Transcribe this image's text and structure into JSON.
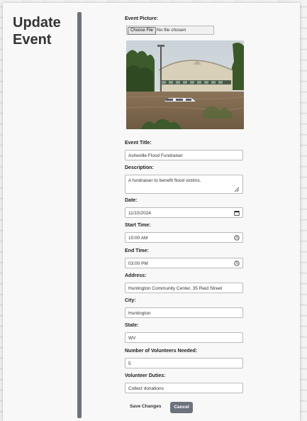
{
  "page": {
    "title_line1": "Update",
    "title_line2": "Event"
  },
  "form": {
    "picture": {
      "label": "Event Picture:",
      "button_label": "Choose File",
      "status": "No file chosen"
    },
    "title": {
      "label": "Event Title:",
      "value": "Asheville Flood Fundraiser"
    },
    "description": {
      "label": "Description:",
      "value": "A fundraiser to benefit flood victims."
    },
    "date": {
      "label": "Date:",
      "value": "11/15/2024"
    },
    "start_time": {
      "label": "Start Time:",
      "value": "10:00 AM"
    },
    "end_time": {
      "label": "End Time:",
      "value": "03:00 PM"
    },
    "address": {
      "label": "Address:",
      "value": "Huntington Community Center, 35 Reid Street"
    },
    "city": {
      "label": "City:",
      "value": "Huntington"
    },
    "state": {
      "label": "State:",
      "value": "WV"
    },
    "volunteers": {
      "label": "Number of Volunteers Needed:",
      "value": "5"
    },
    "duties": {
      "label": "Volunteer Duties:",
      "value": "Collect donations"
    },
    "save_label": "Save Changes",
    "cancel_label": "Cancel"
  },
  "colors": {
    "accent": "#6c737e",
    "card_bg": "#f8f8f8",
    "field_border": "#b9b9b9"
  },
  "icons": {
    "date": "calendar-icon",
    "start_time": "clock-icon",
    "end_time": "clock-icon",
    "description": "resize-handle-icon"
  }
}
